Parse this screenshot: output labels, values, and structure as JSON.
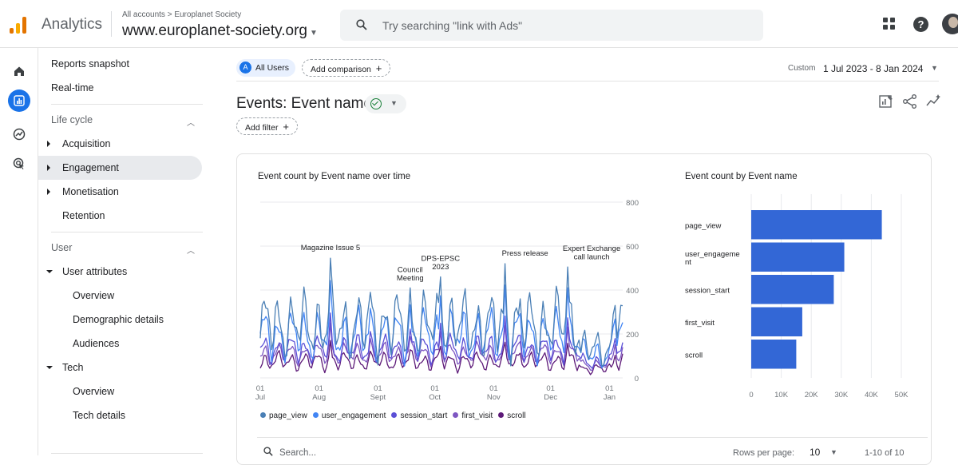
{
  "app": {
    "name": "Analytics",
    "breadcrumb": "All accounts > Europlanet Society",
    "property": "www.europlanet-society.org"
  },
  "search": {
    "placeholder": "Try searching \"link with Ads\""
  },
  "topbar_icons": [
    "apps-grid-icon",
    "help-icon",
    "account-avatar"
  ],
  "rail_icons": [
    "home-icon",
    "reports-icon",
    "explore-icon",
    "advertising-icon"
  ],
  "nav": {
    "reports_snapshot": "Reports snapshot",
    "realtime": "Real-time",
    "lifecycle": {
      "label": "Life cycle",
      "items": [
        {
          "label": "Acquisition"
        },
        {
          "label": "Engagement"
        },
        {
          "label": "Monetisation"
        },
        {
          "label": "Retention"
        }
      ]
    },
    "user": {
      "label": "User",
      "user_attributes": "User attributes",
      "user_attr_items": [
        "Overview",
        "Demographic details",
        "Audiences"
      ],
      "tech": "Tech",
      "tech_items": [
        "Overview",
        "Tech details"
      ]
    }
  },
  "header": {
    "segment_badge": "A",
    "segment_label": "All Users",
    "add_comparison": "Add comparison",
    "date_label": "Custom",
    "date_range": "1 Jul 2023 - 8 Jan 2024",
    "title": "Events: Event name",
    "add_filter": "Add filter"
  },
  "colors": {
    "page_view": "#4a7fb5",
    "user_engagement": "#4285f4",
    "session_start": "#5b4fd6",
    "first_visit": "#7e57c2",
    "scroll": "#5d1a78",
    "bar": "#3367d6",
    "accent": "#1a73e8"
  },
  "chart_data": [
    {
      "type": "line",
      "title": "Event count by Event name over time",
      "x_tick_labels": [
        [
          "01",
          "Jul"
        ],
        [
          "01",
          "Aug"
        ],
        [
          "01",
          "Sept"
        ],
        [
          "01",
          "Oct"
        ],
        [
          "01",
          "Nov"
        ],
        [
          "01",
          "Dec"
        ],
        [
          "01",
          "Jan"
        ]
      ],
      "x_range": [
        "2023-07-01",
        "2024-01-08"
      ],
      "y_ticks": [
        0,
        200,
        400,
        600,
        800
      ],
      "ylim": [
        0,
        800
      ],
      "grid": true,
      "legend_position": "bottom",
      "series": [
        {
          "name": "page_view",
          "base": 240,
          "amp": 140,
          "min": 55
        },
        {
          "name": "user_engagement",
          "base": 195,
          "amp": 110,
          "min": 45
        },
        {
          "name": "session_start",
          "base": 130,
          "amp": 60,
          "min": 30
        },
        {
          "name": "first_visit",
          "base": 110,
          "amp": 45,
          "min": 25
        },
        {
          "name": "scroll",
          "base": 75,
          "amp": 40,
          "min": 15
        }
      ],
      "peaks": [
        {
          "date": "2023-08-07",
          "value": 545
        },
        {
          "date": "2023-08-28",
          "value": 390
        },
        {
          "date": "2023-09-18",
          "value": 410
        },
        {
          "date": "2023-10-04",
          "value": 460
        },
        {
          "date": "2023-11-07",
          "value": 520
        },
        {
          "date": "2023-11-15",
          "value": 360
        },
        {
          "date": "2023-12-10",
          "value": 505
        },
        {
          "date": "2024-01-04",
          "value": 330
        }
      ],
      "annotations": [
        {
          "label": "Magazine Issue 5",
          "lines": [
            "Magazine Issue 5"
          ]
        },
        {
          "label": "Council Meeting",
          "lines": [
            "Council",
            "Meeting"
          ]
        },
        {
          "label": "DPS-EPSC 2023",
          "lines": [
            "DPS-EPSC",
            "2023"
          ]
        },
        {
          "label": "Press release",
          "lines": [
            "Press release"
          ]
        },
        {
          "label": "Expert Exchange call launch",
          "lines": [
            "Expert Exchange",
            "call launch"
          ]
        }
      ]
    },
    {
      "type": "bar",
      "orientation": "horizontal",
      "title": "Event count by Event name",
      "categories": [
        [
          "page_view"
        ],
        [
          "user_engageme",
          "nt"
        ],
        [
          "session_start"
        ],
        [
          "first_visit"
        ],
        [
          "scroll"
        ]
      ],
      "values": [
        43500,
        31000,
        27500,
        17000,
        15000
      ],
      "x_ticks": [
        "0",
        "10K",
        "20K",
        "30K",
        "40K",
        "50K"
      ],
      "xlim": [
        0,
        50000
      ],
      "grid": true
    }
  ],
  "table": {
    "search_placeholder": "Search...",
    "rows_per_page_label": "Rows per page:",
    "rows_per_page": "10",
    "pagination": "1-10 of 10"
  }
}
